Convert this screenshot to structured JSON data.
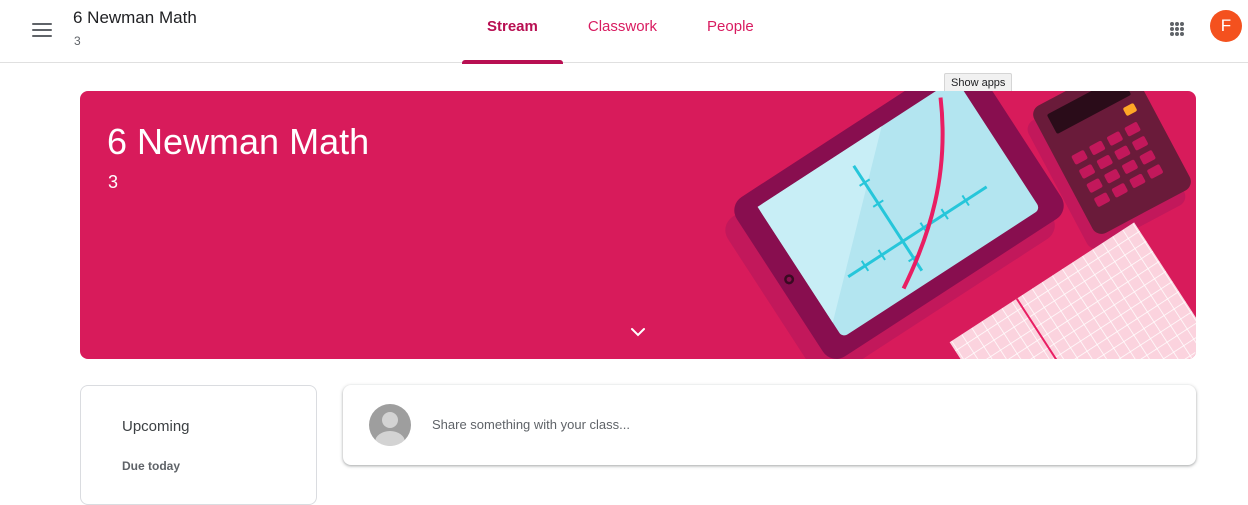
{
  "header": {
    "class_title": "6 Newman Math",
    "class_section": "3",
    "tabs": [
      {
        "label": "Stream",
        "active": true
      },
      {
        "label": "Classwork",
        "active": false
      },
      {
        "label": "People",
        "active": false
      }
    ],
    "apps_tooltip": "Show apps",
    "avatar_letter": "F",
    "avatar_color": "#f4511e",
    "accent_color": "#d81b5b"
  },
  "banner": {
    "title": "6 Newman Math",
    "section": "3"
  },
  "upcoming": {
    "title": "Upcoming",
    "due_label": "Due today"
  },
  "share": {
    "placeholder": "Share something with your class..."
  }
}
